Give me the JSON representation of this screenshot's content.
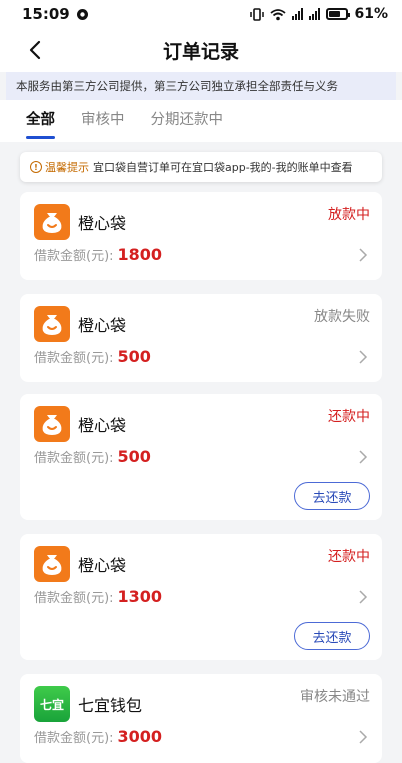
{
  "status_bar": {
    "time": "15:09",
    "battery": "61%",
    "network": "5G"
  },
  "header": {
    "title": "订单记录"
  },
  "notice": "本服务由第三方公司提供，第三方公司独立承担全部责任与义务",
  "tabs": [
    {
      "label": "全部",
      "active": true
    },
    {
      "label": "审核中",
      "active": false
    },
    {
      "label": "分期还款中",
      "active": false
    }
  ],
  "tip": {
    "icon": "!",
    "label": "温馨提示",
    "text": "宜口袋自营订单可在宜口袋app-我的-我的账单中查看"
  },
  "orders": [
    {
      "name": "橙心袋",
      "status": "放款中",
      "status_color": "#d42020",
      "amount_label": "借款金额(元):",
      "amount": "1800",
      "logo": "money-bag-icon"
    },
    {
      "name": "橙心袋",
      "status": "放款失败",
      "status_color": "#888888",
      "amount_label": "借款金额(元):",
      "amount": "500",
      "logo": "money-bag-icon"
    },
    {
      "name": "橙心袋",
      "status": "还款中",
      "status_color": "#d42020",
      "amount_label": "借款金额(元):",
      "amount": "500",
      "logo": "money-bag-icon",
      "action": "去还款"
    },
    {
      "name": "橙心袋",
      "status": "还款中",
      "status_color": "#d42020",
      "amount_label": "借款金额(元):",
      "amount": "1300",
      "logo": "money-bag-icon",
      "action": "去还款"
    },
    {
      "name": "七宜钱包",
      "status": "审核未通过",
      "status_color": "#888888",
      "amount_label": "借款金额(元):",
      "amount": "3000",
      "logo_text": "七宜"
    }
  ],
  "colors": {
    "accent": "#1f4fd1",
    "red": "#d42020",
    "orange_logo": "#f27a1a",
    "green_logo": "#19a33a"
  }
}
